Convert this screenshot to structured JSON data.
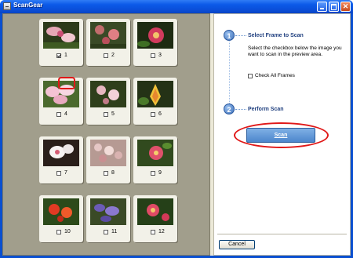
{
  "window": {
    "title": "ScanGear"
  },
  "titlebar_buttons": [
    "minimize",
    "maximize",
    "close"
  ],
  "frames": [
    {
      "number": "1",
      "checked": true
    },
    {
      "number": "2",
      "checked": false
    },
    {
      "number": "3",
      "checked": false
    },
    {
      "number": "4",
      "checked": false
    },
    {
      "number": "5",
      "checked": false
    },
    {
      "number": "6",
      "checked": false
    },
    {
      "number": "7",
      "checked": false
    },
    {
      "number": "8",
      "checked": false
    },
    {
      "number": "9",
      "checked": false
    },
    {
      "number": "10",
      "checked": false
    },
    {
      "number": "11",
      "checked": false
    },
    {
      "number": "12",
      "checked": false
    }
  ],
  "steps": [
    {
      "number": "1",
      "title": "Select Frame to Scan"
    },
    {
      "number": "2",
      "title": "Perform Scan"
    }
  ],
  "step1": {
    "description": "Select the checkbox below the image you want to scan in the preview area.",
    "check_all_label": "Check All Frames",
    "check_all_checked": false
  },
  "step2": {
    "scan_label": "Scan"
  },
  "footer": {
    "cancel_label": "Cancel"
  },
  "colors": {
    "highlight": "#e01818",
    "titlebar": "#0a4fd0",
    "preview_bg": "#a19e8c"
  }
}
